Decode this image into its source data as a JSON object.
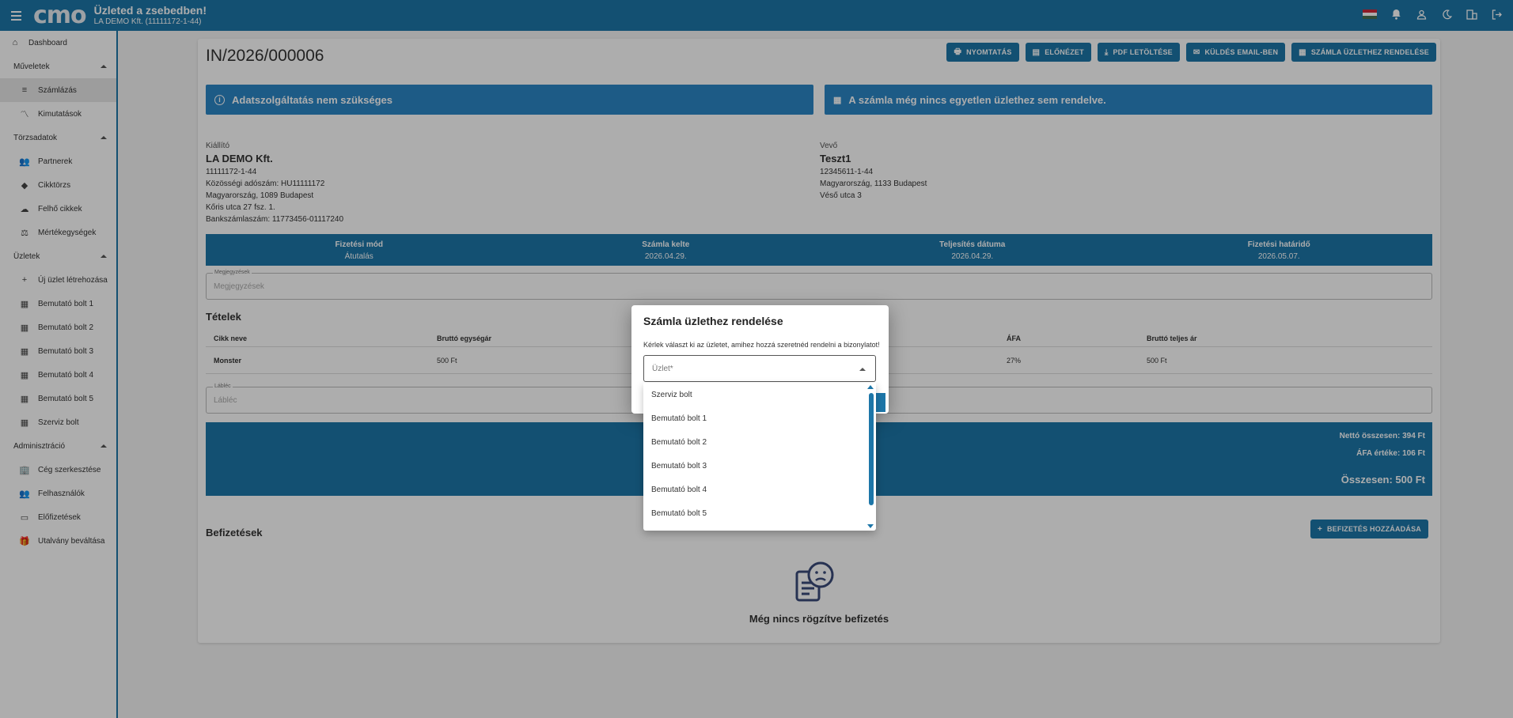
{
  "header": {
    "logo": "cmo",
    "title": "Üzleted a zsebedben!",
    "subtitle": "LA DEMO Kft. (11111172-1-44)"
  },
  "sidebar": {
    "dashboard": "Dashboard",
    "sections": [
      {
        "title": "Műveletek",
        "items": [
          "Számlázás",
          "Kimutatások"
        ]
      },
      {
        "title": "Törzsadatok",
        "items": [
          "Partnerek",
          "Cikktörzs",
          "Felhő cikkek",
          "Mértékegységek"
        ]
      },
      {
        "title": "Üzletek",
        "items": [
          "Új üzlet létrehozása",
          "Bemutató bolt 1",
          "Bemutató bolt 2",
          "Bemutató bolt 3",
          "Bemutató bolt 4",
          "Bemutató bolt 5",
          "Szerviz bolt"
        ]
      },
      {
        "title": "Adminisztráció",
        "items": [
          "Cég szerkesztése",
          "Felhasználók",
          "Előfizetések",
          "Utalvány beváltása"
        ]
      }
    ]
  },
  "invoice": {
    "number": "IN/2026/000006",
    "actions": [
      "NYOMTATÁS",
      "ELŐNÉZET",
      "PDF LETÖLTÉSE",
      "KÜLDÉS EMAIL-BEN",
      "SZÁMLA ÜZLETHEZ RENDELÉSE"
    ],
    "alert_left": "Adatszolgáltatás nem szükséges",
    "alert_right": "A számla még nincs egyetlen üzlethez sem rendelve.",
    "issuer": {
      "label": "Kiállító",
      "name": "LA DEMO Kft.",
      "lines": [
        "11111172-1-44",
        "Közösségi adószám: HU11111172",
        "Magyarország, 1089 Budapest",
        "Kőris utca 27 fsz. 1.",
        "Bankszámlaszám: 11773456-01117240"
      ]
    },
    "buyer": {
      "label": "Vevő",
      "name": "Teszt1",
      "lines": [
        "12345611-1-44",
        "Magyarország, 1133 Budapest",
        "Véső utca 3"
      ]
    },
    "info": [
      {
        "h": "Fizetési mód",
        "v": "Átutalás"
      },
      {
        "h": "Számla kelte",
        "v": "2026.04.29."
      },
      {
        "h": "Teljesítés dátuma",
        "v": "2026.04.29."
      },
      {
        "h": "Fizetési határidő",
        "v": "2026.05.07."
      }
    ],
    "notes_label": "Megjegyzések",
    "notes_placeholder": "Megjegyzések",
    "items_title": "Tételek",
    "columns": [
      "Cikk neve",
      "Bruttó egységár",
      "ÁFA",
      "Bruttó teljes ár"
    ],
    "row": {
      "name": "Monster",
      "unit": "500 Ft",
      "vat": "27%",
      "total": "500 Ft"
    },
    "footer_label": "Lábléc",
    "footer_placeholder": "Lábléc",
    "totals": {
      "net": "Nettó összesen: 394 Ft",
      "vat": "ÁFA értéke: 106 Ft",
      "gross": "Összesen: 500 Ft"
    },
    "payments_title": "Befizetések",
    "add_payment": "BEFIZETÉS HOZZÁADÁSA",
    "empty_payments": "Még nincs rögzítve befizetés"
  },
  "dialog": {
    "title": "Számla üzlethez rendelése",
    "description": "Kérlek választ ki az üzletet, amihez hozzá szeretnéd rendelni a bizonylatot!",
    "select_label": "Üzlet*",
    "options": [
      "Szerviz bolt",
      "Bemutató bolt 1",
      "Bemutató bolt 2",
      "Bemutató bolt 3",
      "Bemutató bolt 4",
      "Bemutató bolt 5"
    ]
  },
  "colors": {
    "primary": "#1d76a8",
    "alert": "#2c86c6"
  }
}
